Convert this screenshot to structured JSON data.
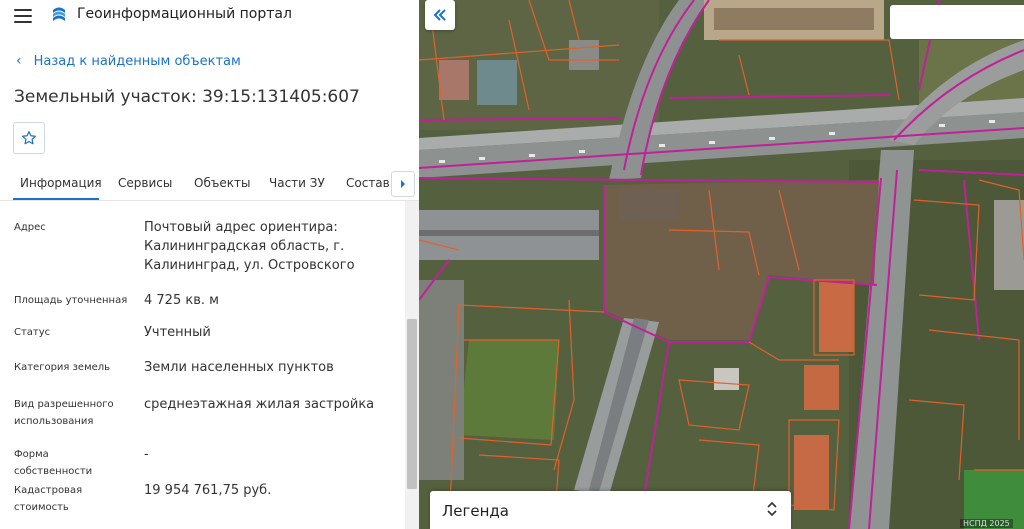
{
  "header": {
    "app_title": "Геоинформационный портал"
  },
  "nav": {
    "back_label": "Назад к найденным объектам"
  },
  "object": {
    "title": "Земельный участок: 39:15:131405:607"
  },
  "tabs": [
    {
      "label": "Информация"
    },
    {
      "label": "Сервисы"
    },
    {
      "label": "Объекты"
    },
    {
      "label": "Части ЗУ"
    },
    {
      "label": "Состав"
    }
  ],
  "info": [
    {
      "label": "Адрес",
      "value": "Почтовый адрес ориентира: Калининградская область, г. Калининград, ул. Островского"
    },
    {
      "label": "Площадь уточненная",
      "value": "4 725 кв. м"
    },
    {
      "label": "Статус",
      "value": "Учтенный"
    },
    {
      "label": "Категория земель",
      "value": "Земли населенных пунктов"
    },
    {
      "label": "Вид разрешенного использования",
      "value": "среднеэтажная жилая застройка"
    },
    {
      "label": "Форма собственности",
      "value": "-"
    },
    {
      "label": "Кадастровая стоимость",
      "value": "19 954 761,75 руб."
    }
  ],
  "map": {
    "legend_label": "Легенда",
    "copyright": "НСПД 2025"
  },
  "icons": {
    "menu": "hamburger-icon",
    "logo": "portal-logo-icon",
    "back": "chevron-left-icon",
    "favorite": "star-icon",
    "tabs_next": "chevron-right-icon",
    "collapse": "double-chevron-left-icon",
    "legend_toggle": "sort-arrows-icon"
  },
  "colors": {
    "accent": "#1a73c9",
    "parcel_border": "#c0209a",
    "subparcel_border": "#e0622a"
  }
}
